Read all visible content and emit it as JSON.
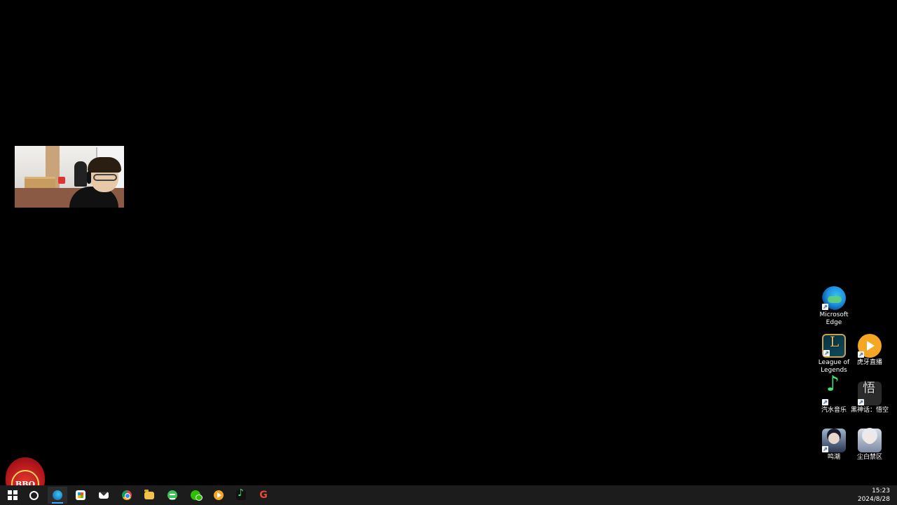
{
  "desktop": {
    "icons": [
      {
        "id": "edge",
        "label": "Microsoft Edge",
        "icon": "edge-icon"
      },
      {
        "id": "lol",
        "label": "League of Legends",
        "icon": "league-of-legends-icon"
      },
      {
        "id": "huya",
        "label": "虎牙直播",
        "icon": "huya-live-icon"
      },
      {
        "id": "qishui",
        "label": "汽水音乐",
        "icon": "qishui-music-icon"
      },
      {
        "id": "wukong",
        "label": "黑神话：悟空",
        "icon": "black-myth-wukong-icon"
      },
      {
        "id": "mingchao",
        "label": "鸣潮",
        "icon": "wuthering-waves-icon"
      },
      {
        "id": "chenbai",
        "label": "尘白禁区",
        "icon": "snowbreak-icon"
      }
    ]
  },
  "logo": {
    "text": "BBQ"
  },
  "taskbar": {
    "items": [
      {
        "id": "start",
        "icon": "windows-start-icon"
      },
      {
        "id": "search",
        "icon": "search-icon"
      },
      {
        "id": "edge",
        "icon": "edge-icon",
        "active": true
      },
      {
        "id": "store",
        "icon": "microsoft-store-icon"
      },
      {
        "id": "mail",
        "icon": "mail-icon"
      },
      {
        "id": "chrome",
        "icon": "chrome-icon"
      },
      {
        "id": "explorer",
        "icon": "file-explorer-icon"
      },
      {
        "id": "green-app",
        "icon": "green-app-icon"
      },
      {
        "id": "wechat",
        "icon": "wechat-icon"
      },
      {
        "id": "huya",
        "icon": "huya-live-icon"
      },
      {
        "id": "qishui",
        "icon": "qishui-music-icon"
      },
      {
        "id": "g-app",
        "icon": "g-app-icon",
        "glyph": "G"
      }
    ],
    "clock": {
      "time": "15:23",
      "date": "2024/8/28"
    }
  }
}
